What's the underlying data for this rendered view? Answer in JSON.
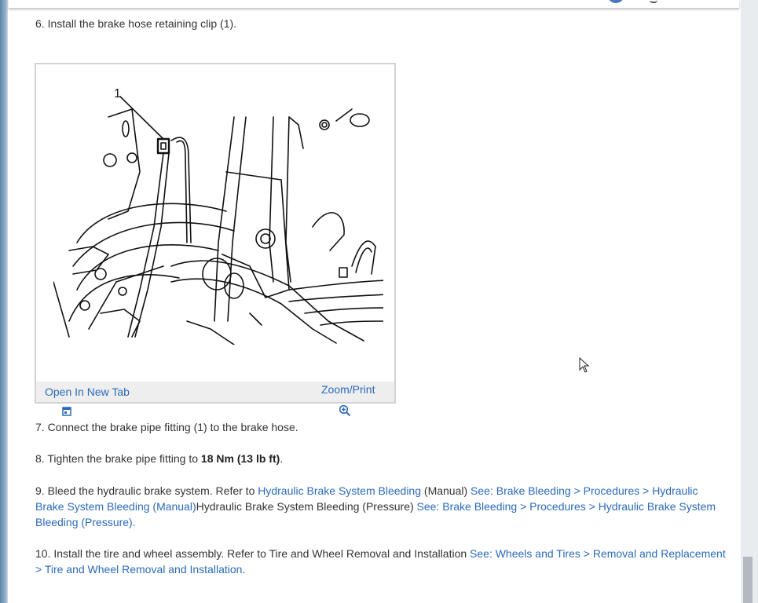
{
  "steps": {
    "s6": {
      "text": "6. Install the brake hose retaining clip (1)."
    },
    "s7": {
      "text": "7. Connect the brake pipe fitting (1) to the brake hose."
    },
    "s8": {
      "prefix": "8. Tighten the brake pipe fitting to ",
      "torque": "18 Nm (13 lb ft)",
      "suffix": "."
    },
    "s9": {
      "prefix": "9. Bleed the hydraulic brake system. Refer to ",
      "link1": "Hydraulic Brake System Bleeding",
      "mid1": " (Manual) ",
      "link2": "See: Brake Bleeding > Procedures > Hydraulic Brake System Bleeding (Manual)",
      "mid2": "Hydraulic Brake System Bleeding (Pressure) ",
      "link3": "See: Brake Bleeding > Procedures > Hydraulic Brake System Bleeding (Pressure)",
      "suffix": "."
    },
    "s10": {
      "prefix": "10. Install the tire and wheel assembly. Refer to Tire and Wheel Removal and Installation ",
      "link1": "See: Wheels and Tires > Removal and Replacement > Tire and Wheel Removal and Installation",
      "suffix": "."
    }
  },
  "figure": {
    "callout": "1",
    "open_new_tab": "Open In New Tab",
    "zoom_print": "Zoom/Print",
    "open_icon": "open-in-new-tab-icon",
    "zoom_icon": "magnifier-zoom-icon"
  },
  "colors": {
    "link": "#2b6ab8",
    "text": "#333333",
    "figure_bar": "#eeeeee"
  }
}
